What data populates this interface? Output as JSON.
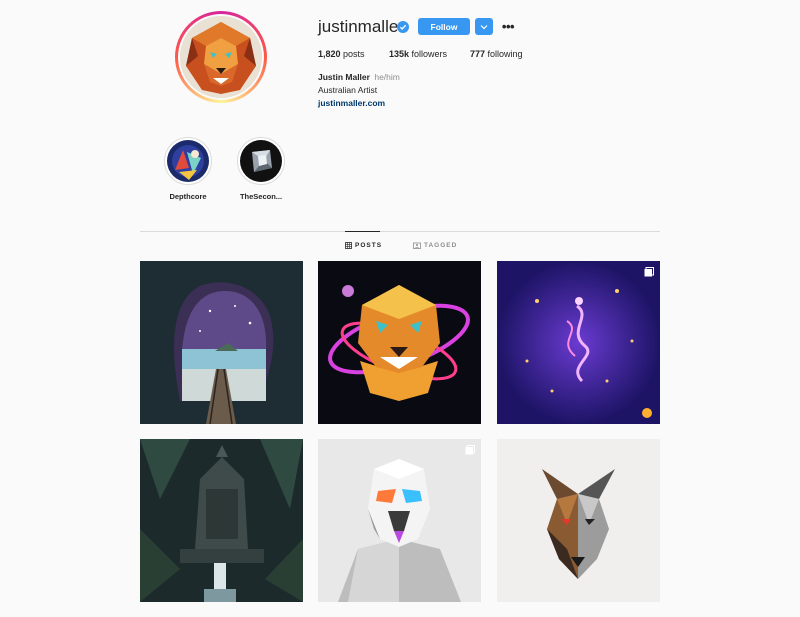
{
  "profile": {
    "username": "justinmaller",
    "follow_label": "Follow",
    "more_label": "•••",
    "posts_count": "1,820",
    "posts_label": "posts",
    "followers_count": "135k",
    "followers_label": "followers",
    "following_count": "777",
    "following_label": "following",
    "full_name": "Justin Maller",
    "pronouns": "he/him",
    "bio": "Australian Artist",
    "website": "justinmaller.com"
  },
  "highlights": [
    {
      "label": "Depthcore"
    },
    {
      "label": "TheSecon..."
    }
  ],
  "tabs": {
    "posts": "POSTS",
    "tagged": "TAGGED"
  },
  "colors": {
    "accent": "#3897f0",
    "link": "#00376b",
    "text": "#262626",
    "muted": "#8e8e8e",
    "background": "#fafafa"
  },
  "posts": [
    {
      "subject": "cave-tunnel-railway",
      "multi": false
    },
    {
      "subject": "neon-tiger-planet",
      "multi": false
    },
    {
      "subject": "purple-particle-figure",
      "multi": true
    },
    {
      "subject": "jungle-temple-waterfall",
      "multi": false
    },
    {
      "subject": "geometric-stormtrooper",
      "multi": true
    },
    {
      "subject": "half-geometric-wolf",
      "multi": false
    }
  ]
}
